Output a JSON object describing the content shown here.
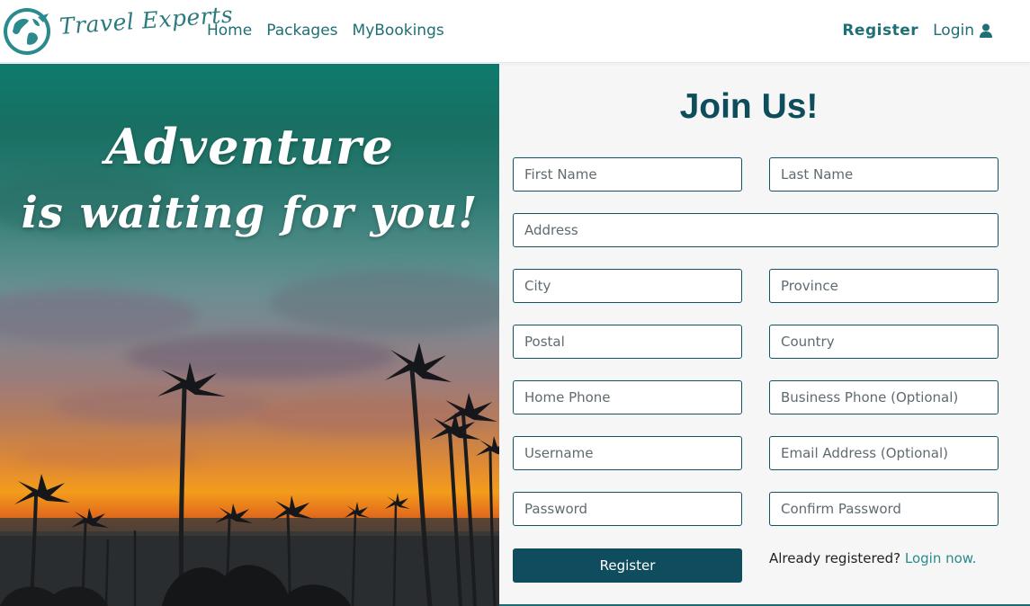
{
  "nav": {
    "brand": "Travel Experts",
    "links": [
      "Home",
      "Packages",
      "MyBookings"
    ],
    "register": "Register",
    "login": "Login",
    "login_icon": "user-icon",
    "logo_icon": "globe-plane-icon"
  },
  "hero": {
    "line1": "Adventure",
    "line2": "is waiting for you!"
  },
  "form": {
    "title": "Join Us!",
    "placeholders": {
      "first_name": "First Name",
      "last_name": "Last Name",
      "address": "Address",
      "city": "City",
      "province": "Province",
      "postal": "Postal",
      "country": "Country",
      "home_phone": "Home Phone",
      "business_phone": "Business Phone (Optional)",
      "username": "Username",
      "email": "Email Address (Optional)",
      "password": "Password",
      "confirm_password": "Confirm Password"
    },
    "register_button": "Register",
    "already_text": "Already registered?",
    "login_now": "Login now."
  },
  "colors": {
    "brand": "#1f6f76",
    "primary_button": "#0f4d5e",
    "field_border": "#125466",
    "panel_bg": "#f6f6f6"
  }
}
